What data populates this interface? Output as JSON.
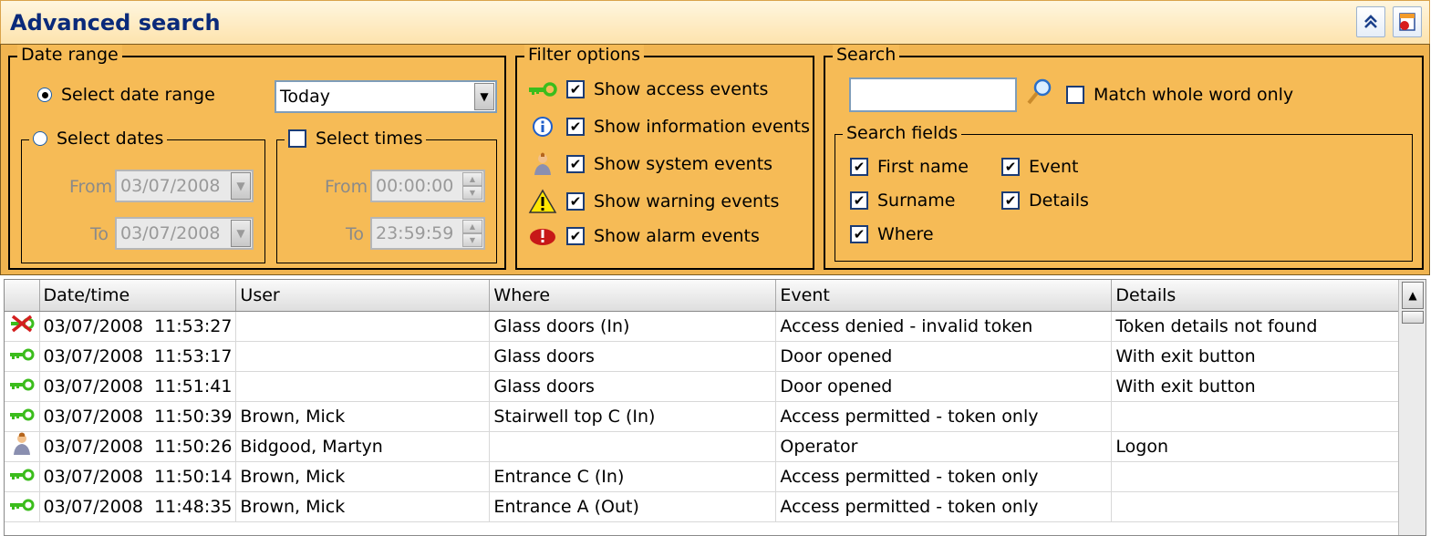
{
  "header": {
    "title": "Advanced search"
  },
  "date_range": {
    "legend": "Date range",
    "select_date_range_label": "Select date range",
    "range_value": "Today",
    "select_dates_label": "Select dates",
    "from_label": "From",
    "to_label": "To",
    "date_from": "03/07/2008",
    "date_to": "03/07/2008",
    "select_times_label": "Select times",
    "time_from": "00:00:00",
    "time_to": "23:59:59"
  },
  "filter": {
    "legend": "Filter options",
    "items": [
      {
        "label": "Show access events",
        "icon": "key-icon"
      },
      {
        "label": "Show information events",
        "icon": "info-icon"
      },
      {
        "label": "Show system events",
        "icon": "operator-icon"
      },
      {
        "label": "Show warning events",
        "icon": "warning-icon"
      },
      {
        "label": "Show alarm events",
        "icon": "alarm-icon"
      }
    ]
  },
  "search": {
    "legend": "Search",
    "query": "",
    "match_whole_word_label": "Match whole word only",
    "fields_legend": "Search fields",
    "fields": [
      "First name",
      "Event",
      "Surname",
      "Details",
      "Where"
    ]
  },
  "table": {
    "columns": [
      "Date/time",
      "User",
      "Where",
      "Event",
      "Details"
    ],
    "rows": [
      {
        "icon": "denied-icon",
        "datetime": "03/07/2008  11:53:27",
        "user": "",
        "where": "Glass doors (In)",
        "event": "Access denied - invalid token",
        "details": "Token details not found"
      },
      {
        "icon": "key-icon",
        "datetime": "03/07/2008  11:53:17",
        "user": "",
        "where": "Glass doors",
        "event": "Door opened",
        "details": "With exit button"
      },
      {
        "icon": "key-icon",
        "datetime": "03/07/2008  11:51:41",
        "user": "",
        "where": "Glass doors",
        "event": "Door opened",
        "details": "With exit button"
      },
      {
        "icon": "key-icon",
        "datetime": "03/07/2008  11:50:39",
        "user": "Brown, Mick",
        "where": "Stairwell top C (In)",
        "event": "Access permitted - token only",
        "details": ""
      },
      {
        "icon": "operator-icon",
        "datetime": "03/07/2008  11:50:26",
        "user": "Bidgood, Martyn",
        "where": "",
        "event": "Operator",
        "details": "Logon"
      },
      {
        "icon": "key-icon",
        "datetime": "03/07/2008  11:50:14",
        "user": "Brown, Mick",
        "where": "Entrance C (In)",
        "event": "Access permitted - token only",
        "details": ""
      },
      {
        "icon": "key-icon",
        "datetime": "03/07/2008  11:48:35",
        "user": "Brown, Mick",
        "where": "Entrance A (Out)",
        "event": "Access permitted - token only",
        "details": ""
      }
    ]
  }
}
